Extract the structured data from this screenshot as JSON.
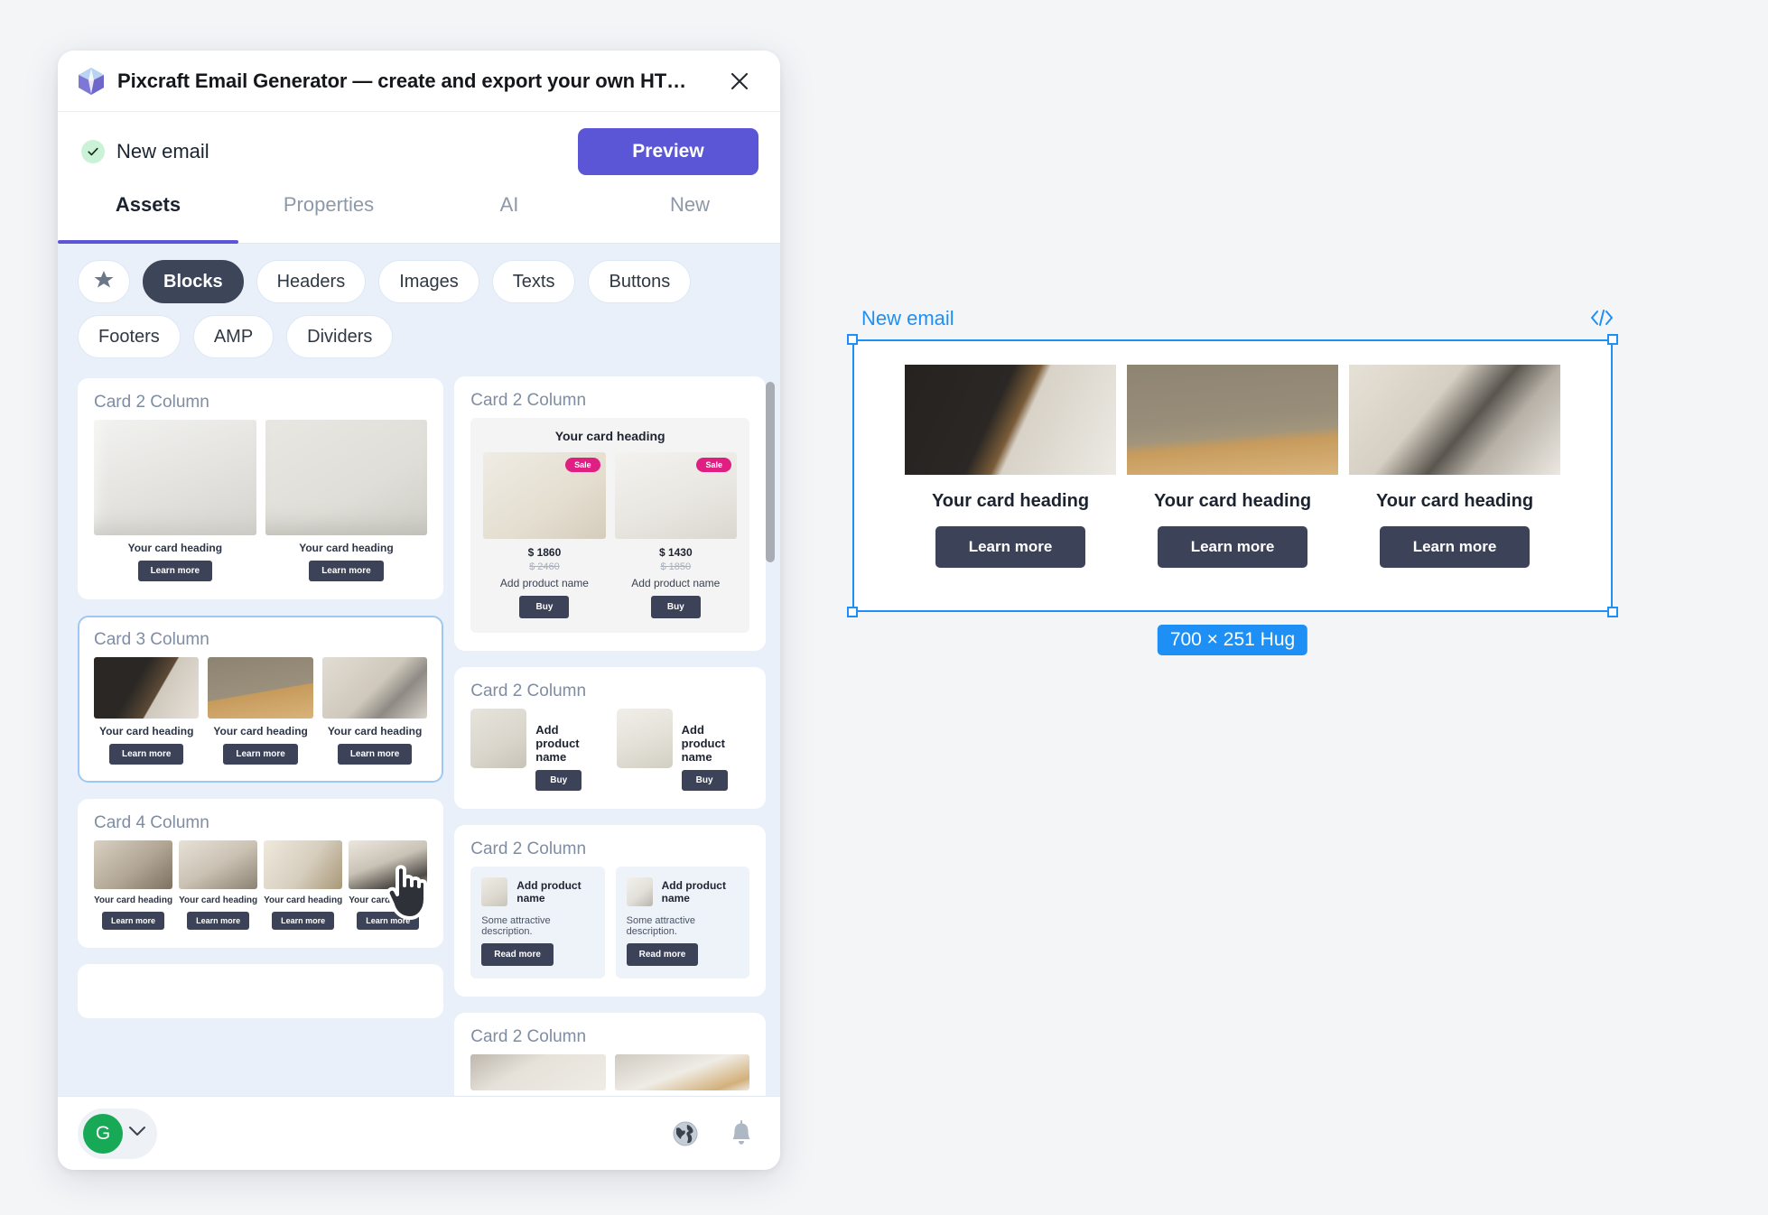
{
  "window": {
    "title": "Pixcraft Email Generator — create and export your own HT…",
    "logo_icon": "gem-cube-icon",
    "close_icon": "close-icon"
  },
  "doc_bar": {
    "status_icon": "check-circle-icon",
    "doc_name": "New email",
    "preview_label": "Preview",
    "accent_color": "#5a56d6",
    "status_color": "#c9f2d7"
  },
  "tabs": [
    {
      "label": "Assets",
      "active": true
    },
    {
      "label": "Properties",
      "active": false
    },
    {
      "label": "AI",
      "active": false
    },
    {
      "label": "New",
      "active": false
    }
  ],
  "chips": [
    {
      "label": "",
      "icon": "star-icon",
      "active": false
    },
    {
      "label": "Blocks",
      "icon": null,
      "active": true
    },
    {
      "label": "Headers",
      "icon": null,
      "active": false
    },
    {
      "label": "Images",
      "icon": null,
      "active": false
    },
    {
      "label": "Texts",
      "icon": null,
      "active": false
    },
    {
      "label": "Buttons",
      "icon": null,
      "active": false
    },
    {
      "label": "Footers",
      "icon": null,
      "active": false
    },
    {
      "label": "AMP",
      "icon": null,
      "active": false
    },
    {
      "label": "Dividers",
      "icon": null,
      "active": false
    }
  ],
  "assets": {
    "left_column": [
      {
        "title": "Card 2 Column",
        "kind": "cards",
        "selected": false,
        "items": [
          {
            "heading": "Your card heading",
            "button": "Learn more"
          },
          {
            "heading": "Your card heading",
            "button": "Learn more"
          }
        ]
      },
      {
        "title": "Card 3 Column",
        "kind": "cards",
        "selected": true,
        "items": [
          {
            "heading": "Your card heading",
            "button": "Learn more"
          },
          {
            "heading": "Your card heading",
            "button": "Learn more"
          },
          {
            "heading": "Your card heading",
            "button": "Learn more"
          }
        ]
      },
      {
        "title": "Card 4 Column",
        "kind": "cards",
        "selected": false,
        "items": [
          {
            "heading": "Your card heading",
            "button": "Learn more"
          },
          {
            "heading": "Your card heading",
            "button": "Learn more"
          },
          {
            "heading": "Your card heading",
            "button": "Learn more"
          },
          {
            "heading": "Your card heading",
            "button": "Learn more"
          }
        ]
      },
      {
        "title": "",
        "kind": "partial",
        "selected": false,
        "items": []
      }
    ],
    "right_column": [
      {
        "title": "Card 2 Column",
        "kind": "sale",
        "heading": "Your card heading",
        "items": [
          {
            "badge": "Sale",
            "price": "$ 1860",
            "price_old": "$ 2460",
            "name": "Add product name",
            "button": "Buy"
          },
          {
            "badge": "Sale",
            "price": "$ 1430",
            "price_old": "$ 1850",
            "name": "Add product name",
            "button": "Buy"
          }
        ]
      },
      {
        "title": "Card 2 Column",
        "kind": "hrow",
        "items": [
          {
            "name": "Add product name",
            "button": "Buy"
          },
          {
            "name": "Add product name",
            "button": "Buy"
          }
        ]
      },
      {
        "title": "Card 2 Column",
        "kind": "desc",
        "items": [
          {
            "name": "Add product name",
            "body": "Some attractive description.",
            "button": "Read more"
          },
          {
            "name": "Add product name",
            "body": "Some attractive description.",
            "button": "Read more"
          }
        ]
      },
      {
        "title": "Card 2 Column",
        "kind": "partial",
        "items": []
      }
    ]
  },
  "footer": {
    "avatar_initial": "G",
    "avatar_color": "#18a957",
    "chevron_icon": "chevron-down-icon",
    "globe_icon": "globe-icon",
    "bell_icon": "bell-icon"
  },
  "canvas": {
    "label": "New email",
    "code_icon": "code-brackets-icon",
    "selection_color": "#1e90f5",
    "size_badge": "700 × 251 Hug",
    "cards": [
      {
        "heading": "Your card heading",
        "button": "Learn more"
      },
      {
        "heading": "Your card heading",
        "button": "Learn more"
      },
      {
        "heading": "Your card heading",
        "button": "Learn more"
      }
    ]
  },
  "cursor": {
    "icon": "pointing-hand-cursor"
  }
}
